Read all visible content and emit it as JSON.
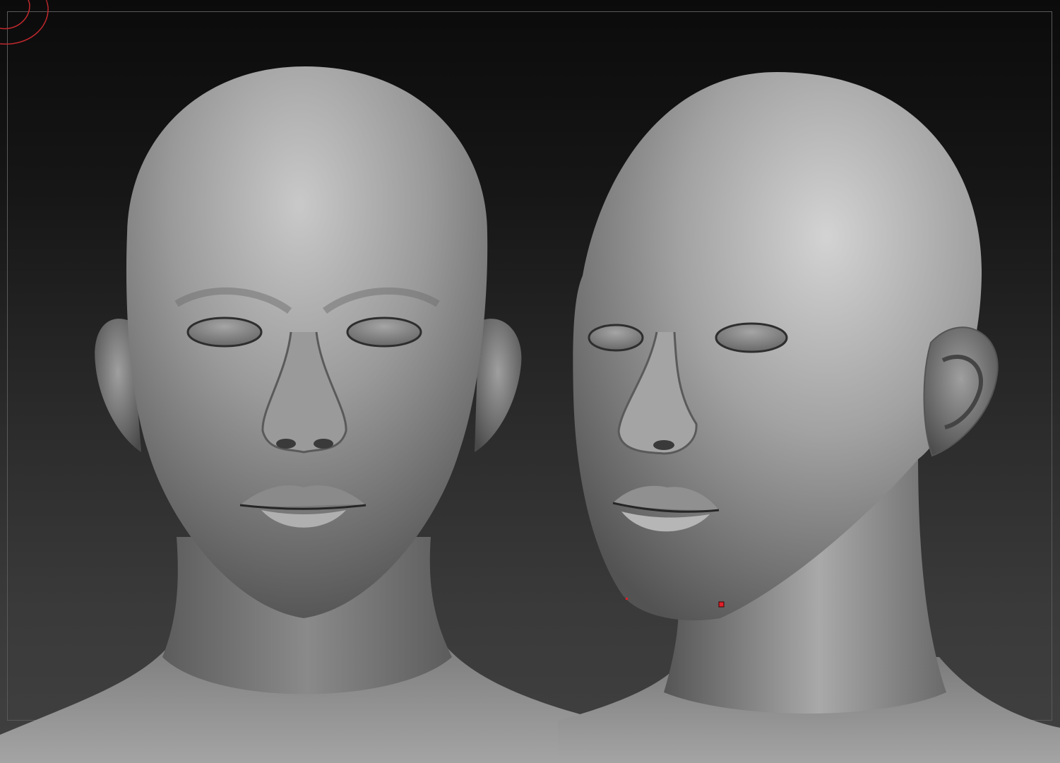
{
  "app": {
    "viewport": "3d-viewport",
    "background_colors": [
      "#0b0b0b",
      "#404040"
    ],
    "frame_color": "#5a5a5a",
    "navigator_color": "#c0282d",
    "marker_color": "#e0202a"
  },
  "models": [
    {
      "id": "head-front",
      "view": "front"
    },
    {
      "id": "head-three-quarter",
      "view": "three-quarter"
    }
  ],
  "icons": {
    "navigator": "orbit-navigator-icon",
    "selection_marker": "selection-point-marker"
  }
}
